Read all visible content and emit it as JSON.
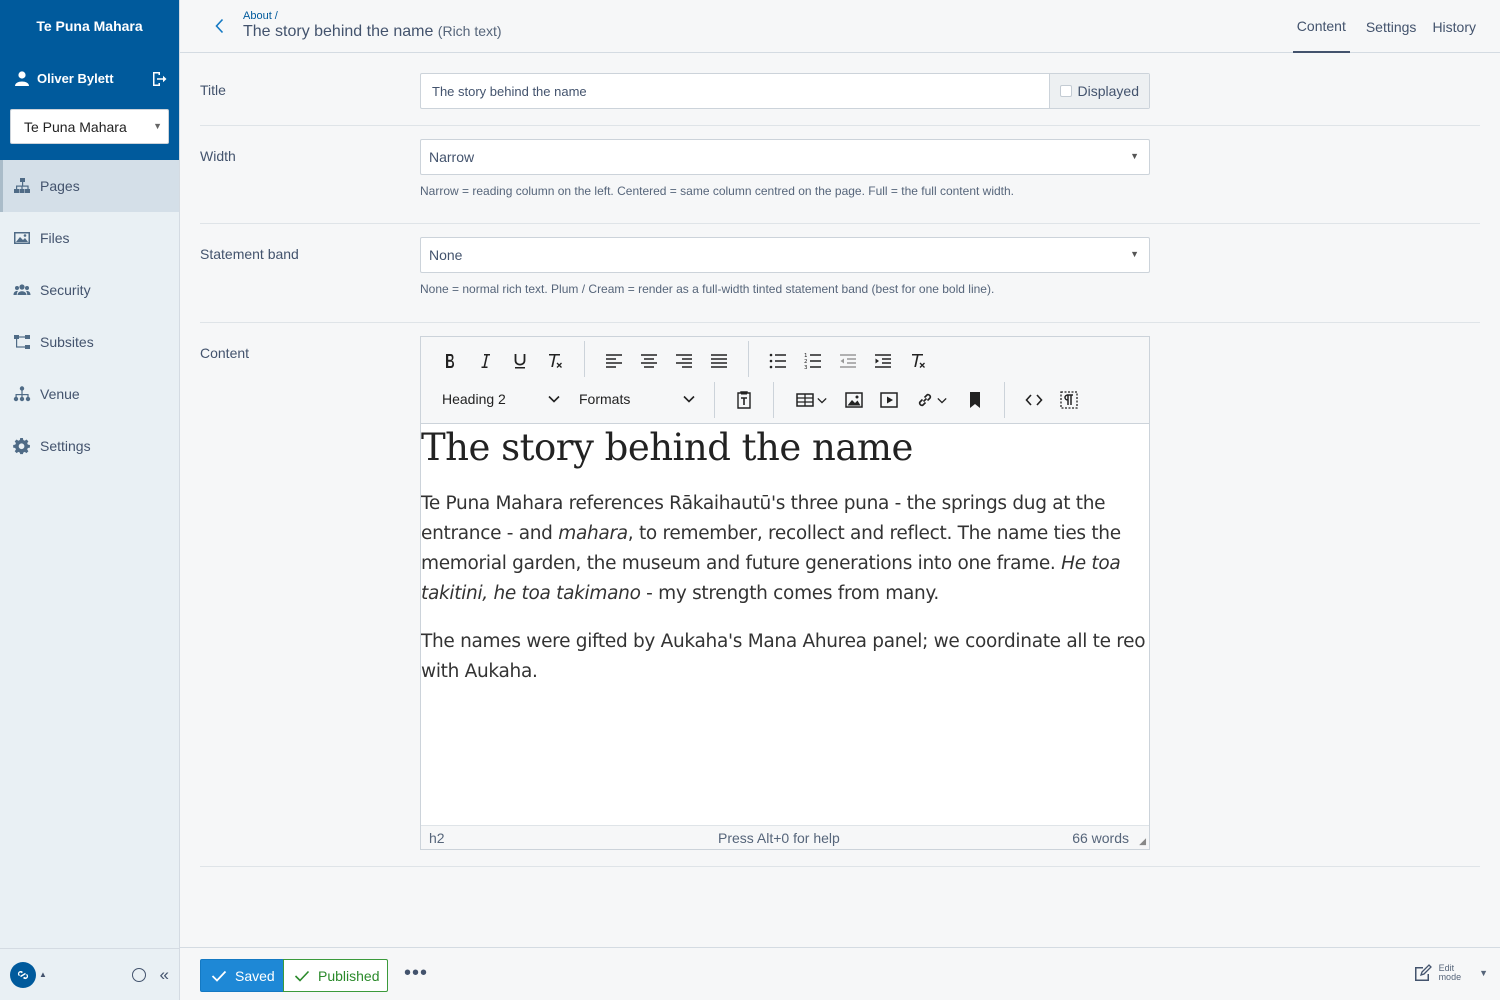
{
  "app": {
    "brand": "Te Puna Mahara",
    "user_name": "Oliver Bylett",
    "subsite_selected": "Te Puna Mahara"
  },
  "sidebar": {
    "items": [
      {
        "label": "Pages",
        "icon": "sitemap-icon",
        "active": true
      },
      {
        "label": "Files",
        "icon": "image-icon",
        "active": false
      },
      {
        "label": "Security",
        "icon": "users-icon",
        "active": false
      },
      {
        "label": "Subsites",
        "icon": "subsites-icon",
        "active": false
      },
      {
        "label": "Venue",
        "icon": "venue-icon",
        "active": false
      },
      {
        "label": "Settings",
        "icon": "gear-icon",
        "active": false
      }
    ],
    "collapse_label": "«"
  },
  "header": {
    "breadcrumb": "About /",
    "title": "The story behind the name",
    "page_type": "(Rich text)",
    "tabs": [
      {
        "label": "Content",
        "active": true
      },
      {
        "label": "Settings",
        "active": false
      },
      {
        "label": "History",
        "active": false
      }
    ]
  },
  "form": {
    "title": {
      "label": "Title",
      "value": "The story behind the name",
      "displayed_label": "Displayed",
      "displayed_checked": false
    },
    "width": {
      "label": "Width",
      "value": "Narrow",
      "help": "Narrow = reading column on the left. Centered = same column centred on the page. Full = the full content width."
    },
    "statement_band": {
      "label": "Statement band",
      "value": "None",
      "help": "None = normal rich text. Plum / Cream = render as a full-width tinted statement band (best for one bold line)."
    },
    "content": {
      "label": "Content",
      "toolbar": {
        "block_format": "Heading 2",
        "formats": "Formats"
      },
      "heading": "The story behind the name",
      "p1": {
        "a": "Te Puna Mahara references Rākaihautū's three puna - the springs dug at the entrance - and ",
        "b": "mahara",
        "c": ", to remember, recollect and reflect. The name ties the memorial garden, the museum and future generations into one frame. ",
        "d": "He toa takitini, he toa takimano",
        "e": " - my strength comes from many."
      },
      "p2": "The names were gifted by Aukaha's Mana Ahurea panel; we coordinate all te reo with Aukaha.",
      "status_path": "h2",
      "status_help": "Press Alt+0 for help",
      "word_count": "66 words"
    }
  },
  "footer": {
    "saved_label": "Saved",
    "published_label": "Published",
    "more_label": "•••",
    "edit_mode_line1": "Edit",
    "edit_mode_line2": "mode"
  },
  "colors": {
    "brand_blue": "#005a9c",
    "saved_blue": "#1e88d6",
    "published_green": "#3b9a3b"
  }
}
